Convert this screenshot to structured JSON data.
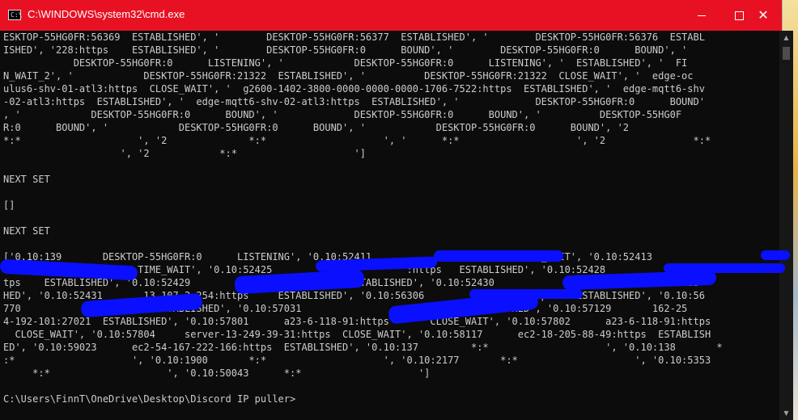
{
  "window": {
    "title": "C:\\WINDOWS\\system32\\cmd.exe",
    "icon": "cmd-icon",
    "accent_color": "#e81123",
    "controls": {
      "minimize": "minimize-icon",
      "maximize": "maximize-icon",
      "close": "close-icon"
    }
  },
  "console": {
    "lines": [
      "ESKTOP-55HG0FR:56369  ESTABLISHED', '        DESKTOP-55HG0FR:56377  ESTABLISHED', '        DESKTOP-55HG0FR:56376  ESTABL",
      "ISHED', '228:https    ESTABLISHED', '        DESKTOP-55HG0FR:0      BOUND', '        DESKTOP-55HG0FR:0      BOUND', '",
      "            DESKTOP-55HG0FR:0      LISTENING', '            DESKTOP-55HG0FR:0      LISTENING', '  ESTABLISHED', '  FI",
      "N_WAIT_2', '            DESKTOP-55HG0FR:21322  ESTABLISHED', '          DESKTOP-55HG0FR:21322  CLOSE_WAIT', '  edge-oc",
      "ulus6-shv-01-atl3:https  CLOSE_WAIT', '  g2600-1402-3800-0000-0000-0000-1706-7522:https  ESTABLISHED', '  edge-mqtt6-shv",
      "-02-atl3:https  ESTABLISHED', '  edge-mqtt6-shv-02-atl3:https  ESTABLISHED', '             DESKTOP-55HG0FR:0      BOUND'",
      ", '            DESKTOP-55HG0FR:0      BOUND', '             DESKTOP-55HG0FR:0      BOUND', '          DESKTOP-55HG0F",
      "R:0      BOUND', '            DESKTOP-55HG0FR:0      BOUND', '            DESKTOP-55HG0FR:0      BOUND', '2",
      "*:*                    ', '2              *:*                    ', '      *:*                    ', '2               *:*",
      "                    ', '2            *:*                    ']",
      "",
      "NEXT SET",
      "",
      "[]",
      "",
      "NEXT SET",
      "",
      "['0.10:139       DESKTOP-55HG0FR:0      LISTENING', '0.10:52411                         TIME_WAIT', '0.10:52413",
      "                       TIME_WAIT', '0.10:52425                       :https   ESTABLISHED', '0.10:52428                  2.nc",
      "tps    ESTABLISHED', '0.10:52429                  https    ESTABLISHED', '0.10:52430                  https    ESTABLIS",
      "HED', '0.10:52431       13.107.3.254:https     ESTABLISHED', '0.10:56306                 https    ESTABLISHED', '0.10:56",
      "770              :223     ESTABLISHED', '0.10:57031                  :https    ESTABLISHED', '0.10:57129       162-25",
      "4-192-101:27021  ESTABLISHED', '0.10:57801      a23-6-118-91:https       CLOSE_WAIT', '0.10:57802      a23-6-118-91:https",
      "  CLOSE_WAIT', '0.10:57804     server-13-249-39-31:https  CLOSE_WAIT', '0.10:58117      ec2-18-205-88-49:https  ESTABLISH",
      "ED', '0.10:59023      ec2-54-167-222-166:https  ESTABLISHED', '0.10:137         *:*                    ', '0.10:138       *",
      ":*                    ', '0.10:1900       *:*                    ', '0.10:2177       *:*                    ', '0.10:5353",
      "     *:*                    ', '0.10:50043      *:*                    ']",
      "",
      "C:\\Users\\FinnT\\OneDrive\\Desktop\\Discord IP puller>"
    ]
  },
  "colors": {
    "console_bg": "#0c0c0c",
    "console_fg": "#cccccc",
    "redaction": "#0a10ff"
  }
}
